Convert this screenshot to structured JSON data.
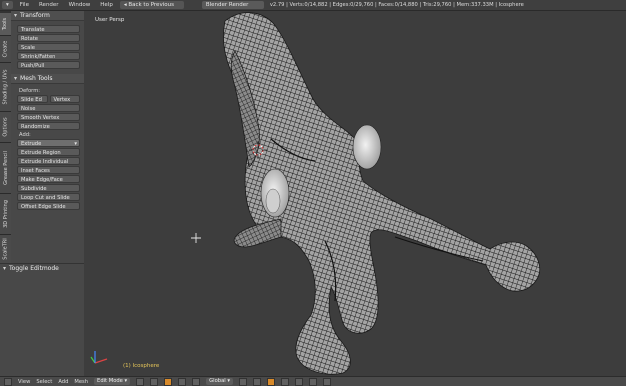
{
  "topbar": {
    "menus": [
      "File",
      "Render",
      "Window",
      "Help"
    ],
    "back_label": "Back to Previous",
    "engine_label": "Blender Render",
    "stats": "v2.79 | Verts:0/14,882 | Edges:0/29,760 | Faces:0/14,880 | Tris:29,760 | Mem:337.33M | Icosphere"
  },
  "left_tabs": [
    "Tools",
    "Create",
    "Shading / UVs",
    "Options",
    "Grease Pencil",
    "3D Printing",
    "ScaleTRI"
  ],
  "transform": {
    "title": "Transform",
    "buttons": [
      "Translate",
      "Rotate",
      "Scale",
      "Shrink/Fatten",
      "Push/Pull"
    ]
  },
  "mesh_tools": {
    "title": "Mesh Tools",
    "deform_label": "Deform:",
    "slide_edge": "Slide Ed",
    "vertex": "Vertex",
    "noise": "Noise",
    "smooth_vertex": "Smooth Vertex",
    "randomize": "Randomize",
    "add_label": "Add:",
    "extrude": "Extrude",
    "extrude_region": "Extrude Region",
    "extrude_individual": "Extrude Individual",
    "inset_faces": "Inset Faces",
    "make_edge_face": "Make Edge/Face",
    "subdivide": "Subdivide",
    "loop_cut_slide": "Loop Cut and Slide",
    "offset_edge_slide": "Offset Edge Slide"
  },
  "toggle_editmode": "Toggle Editmode",
  "viewport": {
    "view_label": "User Persp",
    "object_label": "(1) Icosphere"
  },
  "statusbar": {
    "menus": [
      "View",
      "Select",
      "Add",
      "Mesh"
    ],
    "mode": "Edit Mode",
    "orientation": "Global"
  },
  "colors": {
    "accent": "#d88a2a",
    "viewport_bg": "#3d3d3d",
    "mesh_wire": "#0c0c0c",
    "mesh_fill": "#9a9a9a"
  }
}
